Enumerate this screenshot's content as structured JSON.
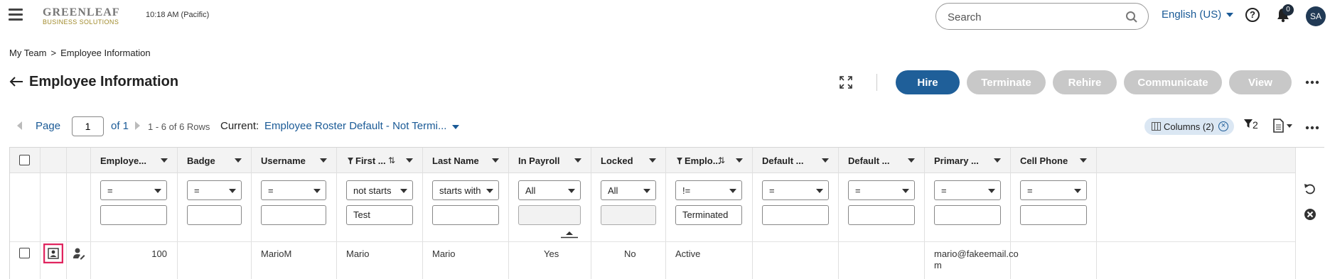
{
  "header": {
    "logo_main": "GREENLEAF",
    "logo_sub": "BUSINESS SOLUTIONS",
    "time": "10:18 AM (Pacific)",
    "search_placeholder": "Search",
    "language": "English (US)",
    "help_glyph": "?",
    "notification_count": "0",
    "avatar_initials": "SA"
  },
  "breadcrumb": {
    "parent": "My Team",
    "separator": ">",
    "current": "Employee Information"
  },
  "page": {
    "title": "Employee Information"
  },
  "actions": {
    "hire": "Hire",
    "terminate": "Terminate",
    "rehire": "Rehire",
    "communicate": "Communicate",
    "view": "View"
  },
  "pager": {
    "page_label": "Page",
    "page_value": "1",
    "of_label": "of 1",
    "rows_text": "1 - 6 of 6 Rows",
    "current_label": "Current:",
    "current_view": "Employee Roster Default - Not Termi...",
    "columns_chip": "Columns (2)",
    "filter_count": "2"
  },
  "grid": {
    "columns": [
      {
        "label": "Employe...",
        "operator": "=",
        "value": ""
      },
      {
        "label": "Badge",
        "operator": "=",
        "value": ""
      },
      {
        "label": "Username",
        "operator": "=",
        "value": ""
      },
      {
        "label": "First ...",
        "operator": "not starts",
        "value": "Test"
      },
      {
        "label": "Last Name",
        "operator": "starts with",
        "value": ""
      },
      {
        "label": "In Payroll",
        "operator": "All",
        "value": ""
      },
      {
        "label": "Locked",
        "operator": "All",
        "value": ""
      },
      {
        "label": "Emplo...",
        "operator": "!=",
        "value": "Terminated"
      },
      {
        "label": "Default ...",
        "operator": "=",
        "value": ""
      },
      {
        "label": "Default ...",
        "operator": "=",
        "value": ""
      },
      {
        "label": "Primary ...",
        "operator": "=",
        "value": ""
      },
      {
        "label": "Cell Phone",
        "operator": "=",
        "value": ""
      }
    ],
    "rows": [
      {
        "employee_id": "100",
        "badge": "",
        "username": "MarioM",
        "first_name": "Mario",
        "last_name": "Mario",
        "in_payroll": "Yes",
        "locked": "No",
        "status": "Active",
        "default1": "",
        "default2": "",
        "primary_email_line1": "mario@fakeemail.co",
        "primary_email_line2": "m",
        "cell_phone": ""
      }
    ]
  },
  "colors": {
    "accent": "#1f5f99",
    "link": "#1a5a96",
    "disabled_button": "#c8c8c8",
    "highlight": "#e0245e",
    "chip_bg": "#dbe7f3"
  },
  "icons": [
    "menu-icon",
    "search-icon",
    "help-icon",
    "bell-icon",
    "back-arrow-icon",
    "expand-icon",
    "more-icon",
    "columns-icon",
    "filter-icon",
    "export-icon",
    "sort-icon",
    "funnel-icon",
    "reset-icon",
    "clear-filter-icon",
    "employee-card-icon",
    "edit-user-icon"
  ]
}
